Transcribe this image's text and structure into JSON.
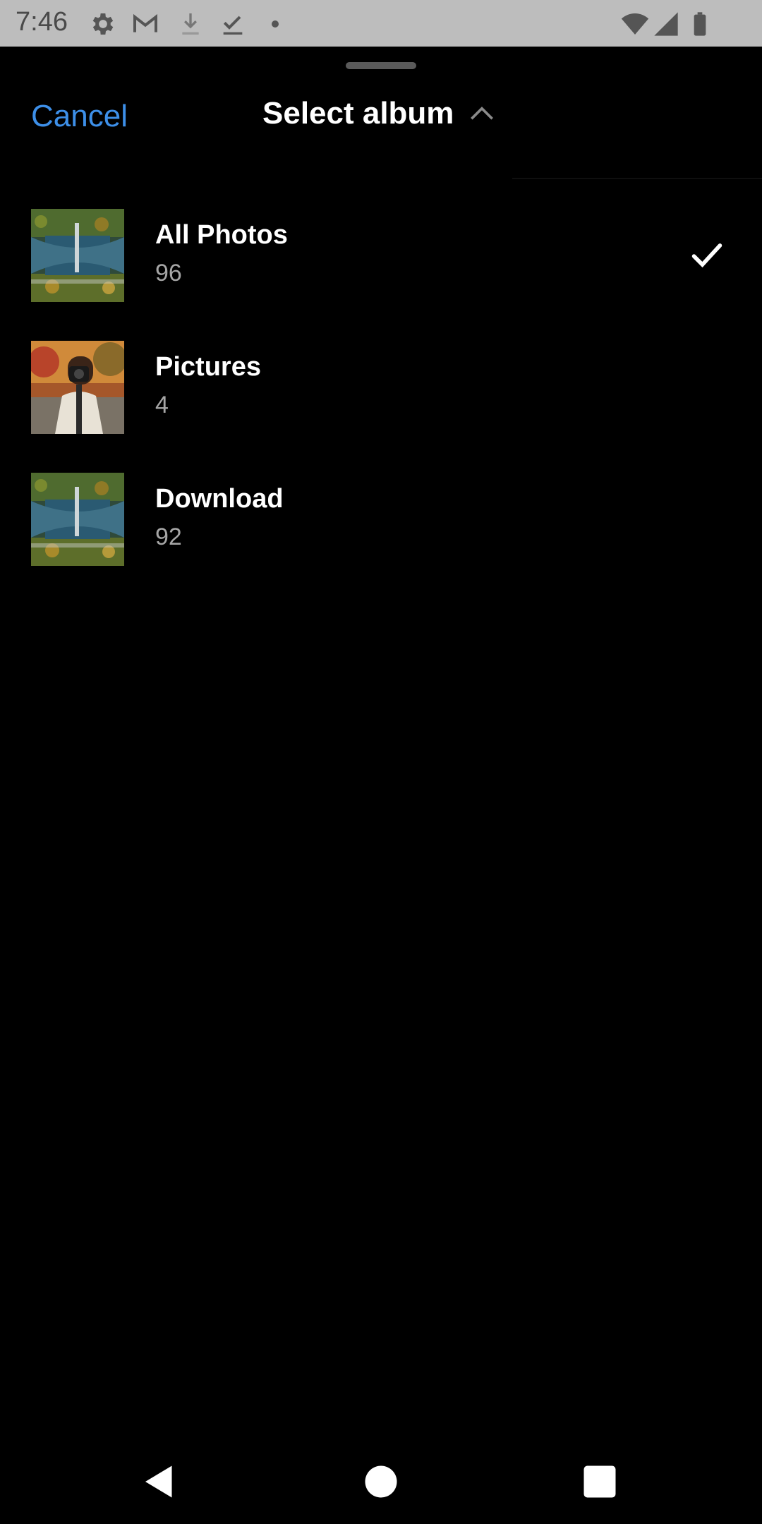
{
  "status_bar": {
    "time": "7:46",
    "icons": [
      "gear-icon",
      "gmail-icon",
      "download-icon",
      "check-download-icon",
      "dot-icon",
      "wifi-icon",
      "signal-icon",
      "battery-icon"
    ]
  },
  "header": {
    "cancel_label": "Cancel",
    "title": "Select album"
  },
  "albums": [
    {
      "name": "All Photos",
      "count": "96",
      "selected": true
    },
    {
      "name": "Pictures",
      "count": "4",
      "selected": false
    },
    {
      "name": "Download",
      "count": "92",
      "selected": false
    }
  ],
  "colors": {
    "accent": "#3d8fe8",
    "background": "#000000",
    "status_bar": "#bdbdbd"
  },
  "nav_bar": {
    "icons": [
      "back-icon",
      "home-icon",
      "recents-icon"
    ]
  }
}
